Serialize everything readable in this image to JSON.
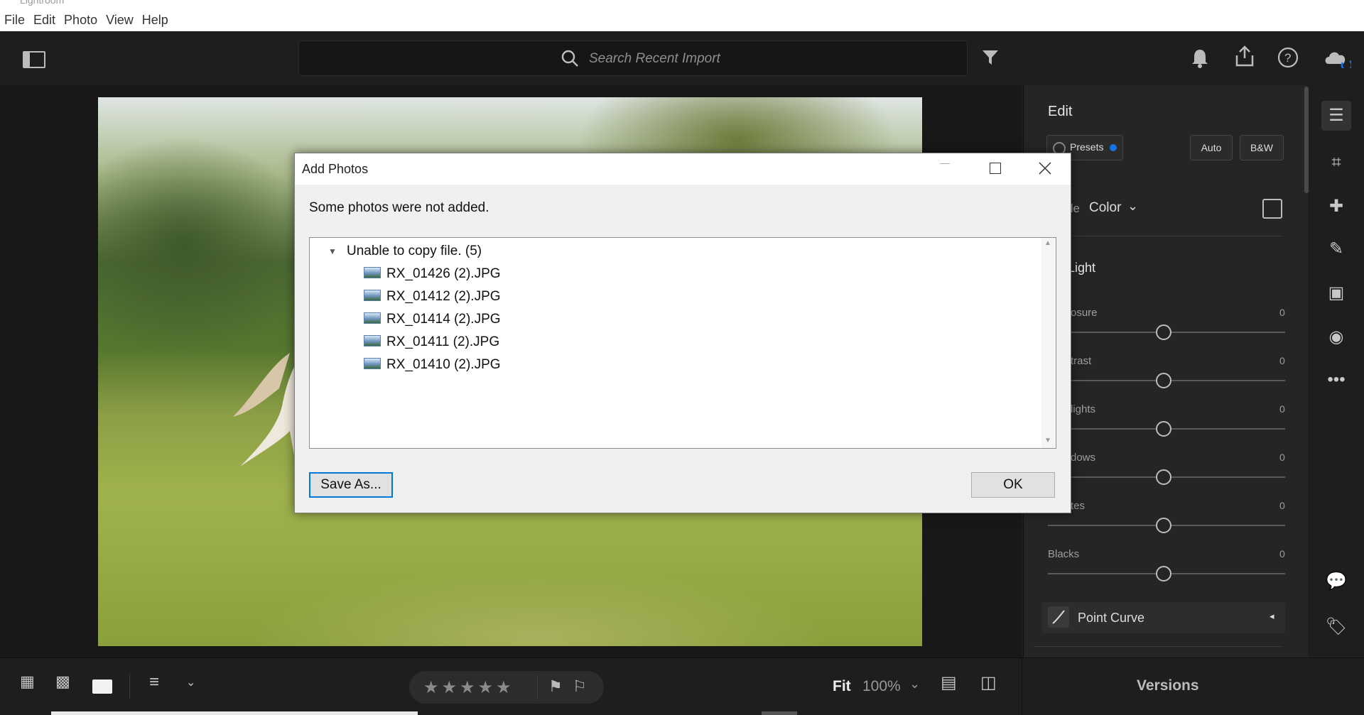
{
  "app": {
    "title": "Lightroom"
  },
  "menu": {
    "items": [
      "File",
      "Edit",
      "Photo",
      "View",
      "Help"
    ]
  },
  "toolbar": {
    "search_placeholder": "Search Recent Import"
  },
  "edit_panel": {
    "title": "Edit",
    "presets_label": "Presets",
    "auto_label": "Auto",
    "bw_label": "B&W",
    "profile_label_partial": "ile",
    "profile_value": "Color",
    "light_section": "Light",
    "sliders": [
      {
        "label": "osure",
        "value": "0"
      },
      {
        "label": "trast",
        "value": "0"
      },
      {
        "label": "lights",
        "value": "0"
      },
      {
        "label": "dows",
        "value": "0"
      },
      {
        "label": "tes",
        "value": "0"
      },
      {
        "label": "Blacks",
        "value": "0"
      }
    ],
    "point_curve_label": "Point Curve",
    "versions_label": "Versions"
  },
  "bottom": {
    "fit_label": "Fit",
    "zoom_value": "100%"
  },
  "dialog": {
    "title": "Add Photos",
    "message": "Some photos were not added.",
    "group_label": "Unable to copy file. (5)",
    "files": [
      "RX_01426 (2).JPG",
      "RX_01412 (2).JPG",
      "RX_01414 (2).JPG",
      "RX_01411 (2).JPG",
      "RX_01410 (2).JPG"
    ],
    "save_as_label": "Save As...",
    "ok_label": "OK"
  },
  "colors": {
    "accent_blue": "#1473e6",
    "panel_bg": "#252525",
    "dialog_bg": "#f0f0f0"
  }
}
